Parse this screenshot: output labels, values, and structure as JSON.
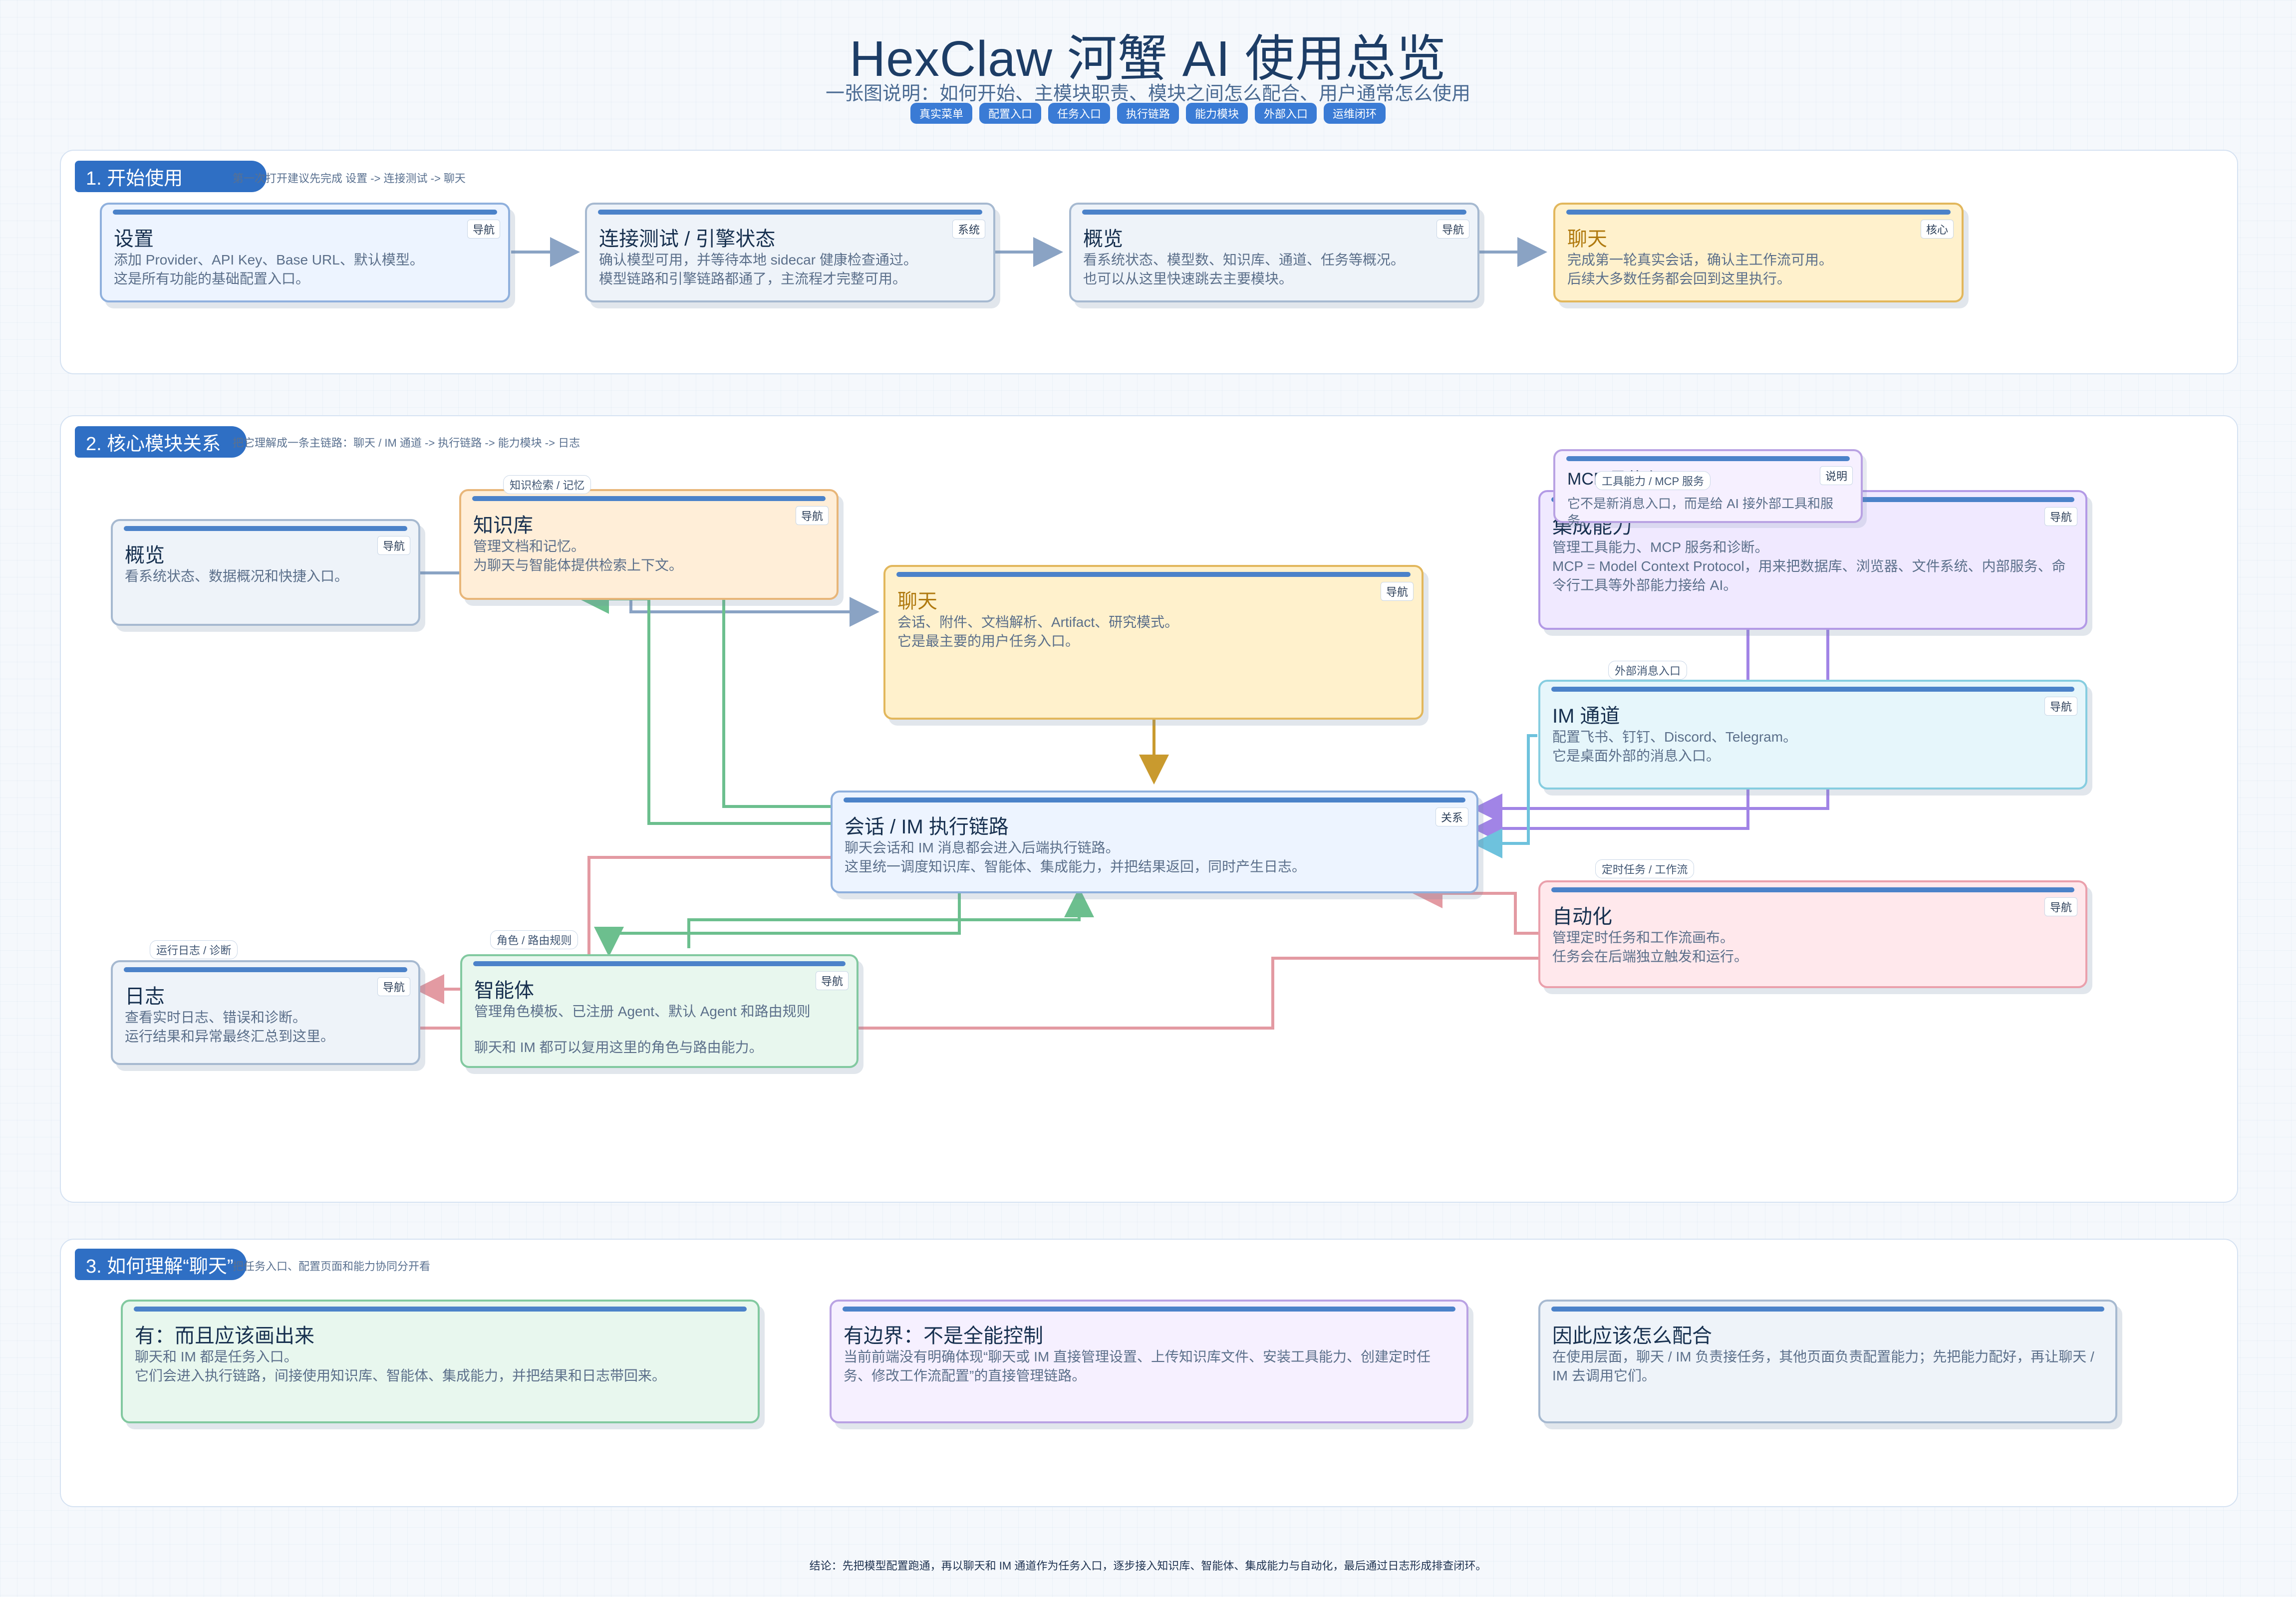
{
  "header": {
    "title": "HexClaw 河蟹 AI 使用总览",
    "subtitle": "一张图说明：如何开始、主模块职责、模块之间怎么配合、用户通常怎么使用",
    "chips": [
      "真实菜单",
      "配置入口",
      "任务入口",
      "执行链路",
      "能力模块",
      "外部入口",
      "运维闭环"
    ]
  },
  "section1": {
    "label": "1. 开始使用",
    "note": "第一次打开建议先完成 设置 -> 连接测试 -> 聊天",
    "cards": [
      {
        "title": "设置",
        "tag": "导航",
        "desc": [
          "添加 Provider、API Key、Base URL、默认模型。",
          "这是所有功能的基础配置入口。"
        ]
      },
      {
        "title": "连接测试 / 引擎状态",
        "tag": "系统",
        "desc": [
          "确认模型可用，并等待本地 sidecar 健康检查通过。",
          "模型链路和引擎链路都通了，主流程才完整可用。"
        ]
      },
      {
        "title": "概览",
        "tag": "导航",
        "desc": [
          "看系统状态、模型数、知识库、通道、任务等概况。",
          "也可以从这里快速跳去主要模块。"
        ]
      },
      {
        "title": "聊天",
        "tag": "核心",
        "desc": [
          "完成第一轮真实会话，确认主工作流可用。",
          "后续大多数任务都会回到这里执行。"
        ]
      }
    ]
  },
  "section2": {
    "label": "2. 核心模块关系",
    "note": "把它理解成一条主链路：聊天 / IM 通道 -> 执行链路 -> 能力模块 -> 日志",
    "overview": {
      "title": "概览",
      "tag": "导航",
      "desc": [
        "看系统状态、数据概况和快捷入口。"
      ]
    },
    "knowledge": {
      "label": "知识检索 / 记忆",
      "title": "知识库",
      "tag": "导航",
      "desc": [
        "管理文档和记忆。",
        "为聊天与智能体提供检索上下文。"
      ]
    },
    "chat": {
      "title": "聊天",
      "tag": "导航",
      "desc": [
        "会话、附件、文档解析、Artifact、研究模式。",
        "它是最主要的用户任务入口。"
      ]
    },
    "integration": {
      "title": "集成能力",
      "tag": "导航",
      "desc": [
        "管理工具能力、MCP 服务和诊断。",
        "MCP = Model Context Protocol，用来把数据库、浏览器、文件系统、内部服务、命令行工具等外部能力接给 AI。"
      ]
    },
    "mcp_note": {
      "label": "工具能力 / MCP 服务",
      "title": "MCP 是什么？",
      "tag": "说明",
      "desc": [
        "它不是新消息入口，而是给 AI 接外部工具和服务。"
      ]
    },
    "im": {
      "label": "外部消息入口",
      "title": "IM 通道",
      "tag": "导航",
      "desc": [
        "配置飞书、钉钉、Discord、Telegram。",
        "它是桌面外部的消息入口。"
      ]
    },
    "pipeline": {
      "title": "会话 / IM 执行链路",
      "tag": "关系",
      "desc": [
        "聊天会话和 IM 消息都会进入后端执行链路。",
        "这里统一调度知识库、智能体、集成能力，并把结果返回，同时产生日志。"
      ]
    },
    "automation": {
      "label": "定时任务 / 工作流",
      "title": "自动化",
      "tag": "导航",
      "desc": [
        "管理定时任务和工作流画布。",
        "任务会在后端独立触发和运行。"
      ]
    },
    "logs": {
      "label": "运行日志 / 诊断",
      "title": "日志",
      "tag": "导航",
      "desc": [
        "查看实时日志、错误和诊断。",
        "运行结果和异常最终汇总到这里。"
      ]
    },
    "agents": {
      "label": "角色 / 路由规则",
      "title": "智能体",
      "tag": "导航",
      "desc": [
        "管理角色模板、已注册 Agent、默认 Agent 和路由规则",
        "聊天和 IM 都可以复用这里的角色与路由能力。"
      ]
    }
  },
  "section3": {
    "label": "3. 如何理解“聊天”",
    "note": "把任务入口、配置页面和能力协同分开看",
    "cards": [
      {
        "title": "有：而且应该画出来",
        "desc": [
          "聊天和 IM 都是任务入口。",
          "它们会进入执行链路，间接使用知识库、智能体、集成能力，并把结果和日志带回来。"
        ]
      },
      {
        "title": "有边界：不是全能控制",
        "desc": [
          "当前前端没有明确体现“聊天或 IM 直接管理设置、上传知识库文件、安装工具能力、创建定时任务、修改工作流配置”的直接管理链路。"
        ]
      },
      {
        "title": "因此应该怎么配合",
        "desc": [
          "在使用层面，聊天 / IM 负责接任务，其他页面负责配置能力；先把能力配好，再让聊天 / IM 去调用它们。"
        ]
      }
    ]
  },
  "footer": {
    "conclusion": "结论：先把模型配置跑通，再以聊天和 IM 通道作为任务入口，逐步接入知识库、智能体、集成能力与自动化，最后通过日志形成排查闭环。"
  },
  "colors": {
    "accent": "#2f6fc4",
    "flow_blue": "#8aa3c4",
    "flow_green": "#6cbf8e",
    "flow_purple": "#a184e6",
    "flow_cyan": "#6ec2dd",
    "flow_red": "#e39aa2",
    "flow_gold": "#c99a2e"
  }
}
